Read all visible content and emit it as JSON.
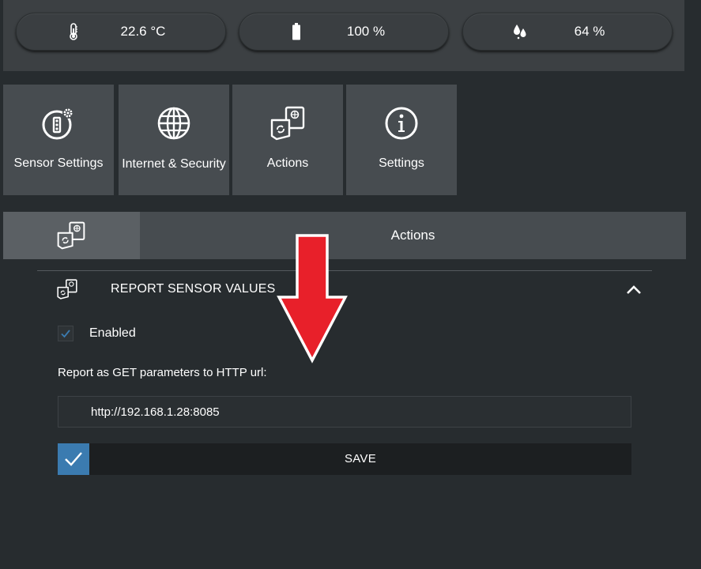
{
  "status_bar": {
    "temperature": {
      "value": "22.6 °C",
      "icon": "thermometer-icon"
    },
    "battery": {
      "value": "100 %",
      "icon": "battery-icon"
    },
    "humidity": {
      "value": "64 %",
      "icon": "droplets-icon"
    }
  },
  "tiles": [
    {
      "label": "Sensor Settings",
      "icon": "sensor-settings-icon"
    },
    {
      "label": "Internet & Security",
      "icon": "globe-icon"
    },
    {
      "label": "Actions",
      "icon": "actions-icon"
    },
    {
      "label": "Settings",
      "icon": "info-icon"
    }
  ],
  "section": {
    "title": "Actions",
    "icon": "actions-icon"
  },
  "panel": {
    "title": "REPORT SENSOR VALUES",
    "enabled_label": "Enabled",
    "enabled": true,
    "url_label": "Report as GET parameters to HTTP url:",
    "url_value": "http://192.168.1.28:8085",
    "save_label": "SAVE"
  },
  "colors": {
    "background": "#272c2f",
    "tile": "#474c50",
    "accent": "#3b7bb0",
    "arrow": "#e8202a"
  }
}
